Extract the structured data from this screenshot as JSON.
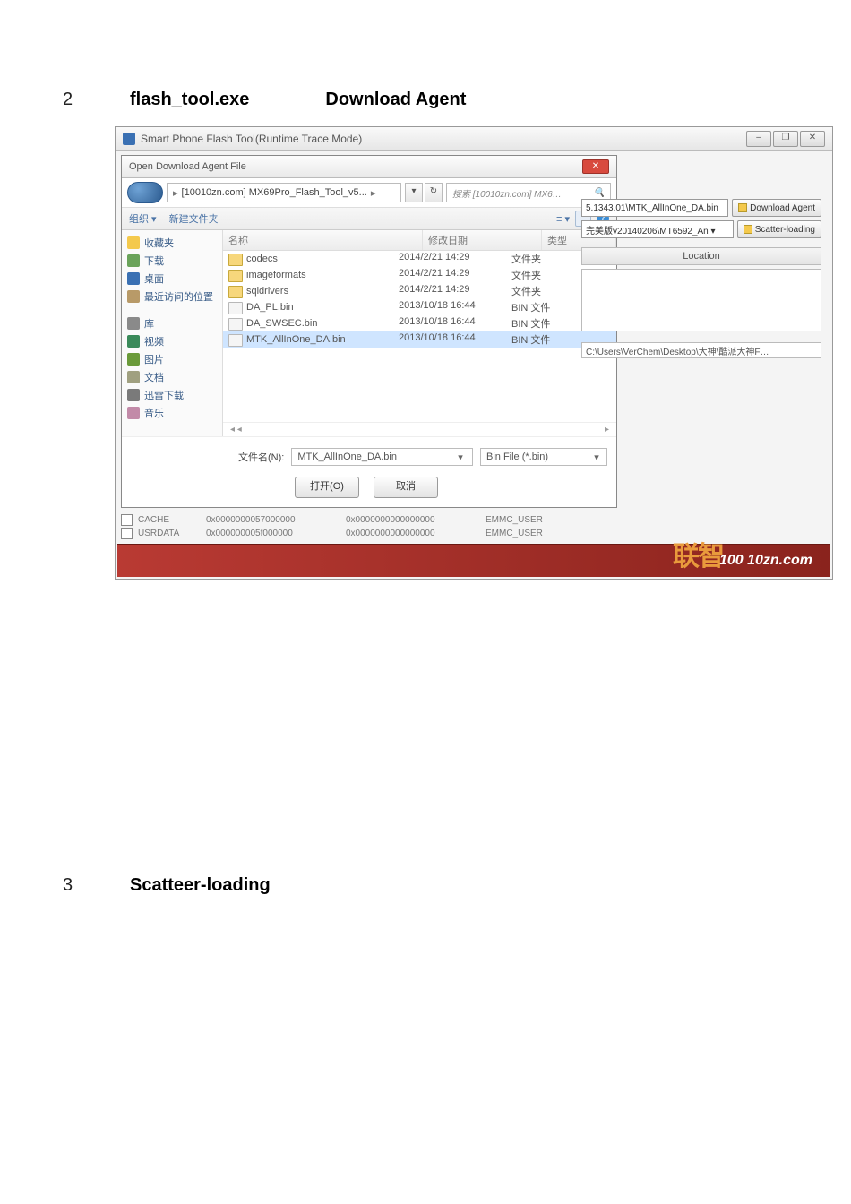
{
  "steps": {
    "s2_num": "2",
    "s2_a": "flash_tool.exe",
    "s2_b": "Download Agent",
    "s3_num": "3",
    "s3_a": "Scatteer-loading"
  },
  "window": {
    "title": "Smart Phone Flash Tool(Runtime Trace Mode)",
    "controls": {
      "min": "–",
      "max": "❐",
      "close": "✕"
    }
  },
  "dialog": {
    "title": "Open Download Agent File",
    "close": "✕",
    "breadcrumb_a": "[10010zn.com] MX69Pro_Flash_Tool_v5...",
    "search_placeholder": "搜索 [10010zn.com] MX6…",
    "toolbar_organize": "组织 ▾",
    "toolbar_newfolder": "新建文件夹",
    "help": "?"
  },
  "sidebar": {
    "fav": "收藏夹",
    "download": "下载",
    "desktop": "桌面",
    "recent": "最近访问的位置",
    "library": "库",
    "video": "视频",
    "picture": "图片",
    "docs": "文档",
    "xunlei": "迅雷下载",
    "music": "音乐"
  },
  "columns": {
    "name": "名称",
    "date": "修改日期",
    "type": "类型"
  },
  "files": [
    {
      "name": "codecs",
      "date": "2014/2/21 14:29",
      "type": "文件夹",
      "kind": "folder"
    },
    {
      "name": "imageformats",
      "date": "2014/2/21 14:29",
      "type": "文件夹",
      "kind": "folder"
    },
    {
      "name": "sqldrivers",
      "date": "2014/2/21 14:29",
      "type": "文件夹",
      "kind": "folder"
    },
    {
      "name": "DA_PL.bin",
      "date": "2013/10/18 16:44",
      "type": "BIN 文件",
      "kind": "file"
    },
    {
      "name": "DA_SWSEC.bin",
      "date": "2013/10/18 16:44",
      "type": "BIN 文件",
      "kind": "file"
    },
    {
      "name": "MTK_AllInOne_DA.bin",
      "date": "2013/10/18 16:44",
      "type": "BIN 文件",
      "kind": "file",
      "selected": true
    }
  ],
  "bottom": {
    "filename_label": "文件名(N):",
    "filename_value": "MTK_AllInOne_DA.bin",
    "filter": "Bin File (*.bin)",
    "open": "打开(O)",
    "cancel": "取消"
  },
  "right": {
    "da_path": "5.1343.01\\MTK_AllInOne_DA.bin",
    "da_btn": "Download Agent",
    "scatter_path_short": "完美版v20140206\\MT6592_An ▾",
    "scatter_btn": "Scatter-loading",
    "location_label": "Location",
    "scatter_full": "C:\\Users\\VerChem\\Desktop\\大神\\酷派大神F…"
  },
  "bg_table": [
    {
      "name": "CACHE",
      "a": "0x0000000057000000",
      "b": "0x0000000000000000",
      "c": "EMMC_USER"
    },
    {
      "name": "USRDATA",
      "a": "0x000000005f000000",
      "b": "0x0000000000000000",
      "c": "EMMC_USER"
    }
  ],
  "brand": {
    "logo": "联智",
    "site": "100 10zn.com"
  }
}
